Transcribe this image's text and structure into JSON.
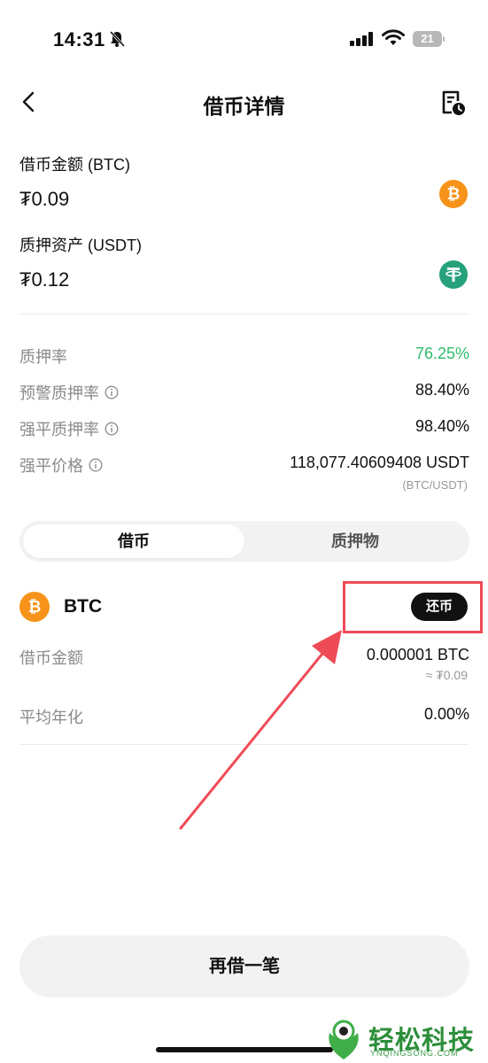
{
  "status_bar": {
    "time": "14:31",
    "battery": "21"
  },
  "header": {
    "title": "借币详情"
  },
  "assets": [
    {
      "label": "借币金额 (BTC)",
      "value": "₮0.09",
      "coin": "BTC",
      "coin_color": "#f7931a"
    },
    {
      "label": "质押资产 (USDT)",
      "value": "₮0.12",
      "coin": "USDT",
      "coin_color": "#26a17b"
    }
  ],
  "ratios": [
    {
      "label": "质押率",
      "value": "76.25%",
      "value_color": "#2ebd6b",
      "info": false
    },
    {
      "label": "预警质押率",
      "value": "88.40%",
      "info": true
    },
    {
      "label": "强平质押率",
      "value": "98.40%",
      "info": true
    },
    {
      "label": "强平价格",
      "value": "118,077.40609408 USDT",
      "unit": "(BTC/USDT)",
      "info": true
    }
  ],
  "tabs": [
    {
      "label": "借币",
      "active": true
    },
    {
      "label": "质押物",
      "active": false
    }
  ],
  "loan": {
    "coin": "BTC",
    "repay_label": "还币",
    "amount_label": "借币金额",
    "amount_value": "0.000001 BTC",
    "amount_sub": "≈ ₮0.09",
    "apr_label": "平均年化",
    "apr_value": "0.00%"
  },
  "actions": {
    "borrow_again_label": "再借一笔"
  },
  "watermark": {
    "text": "轻松科技",
    "url": "YNQINGSONG.COM"
  },
  "colors": {
    "accent_green": "#2ebd6b",
    "annotation_red": "#ef4b57",
    "btc": "#f7931a",
    "usdt": "#26a17b"
  }
}
